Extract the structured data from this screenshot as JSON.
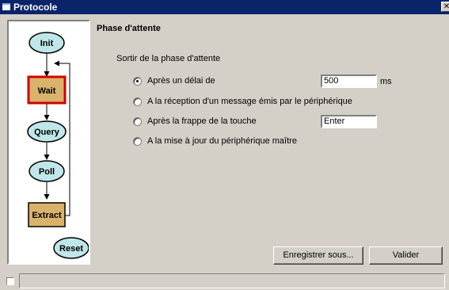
{
  "window": {
    "title": "Protocole",
    "close_glyph": "✕"
  },
  "flow": {
    "nodes": [
      {
        "id": "init",
        "label": "Init",
        "shape": "ellipse",
        "active": false
      },
      {
        "id": "wait",
        "label": "Wait",
        "shape": "box",
        "active": true
      },
      {
        "id": "query",
        "label": "Query",
        "shape": "ellipse",
        "active": false
      },
      {
        "id": "poll",
        "label": "Poll",
        "shape": "ellipse",
        "active": false
      },
      {
        "id": "extract",
        "label": "Extract",
        "shape": "box",
        "active": false
      },
      {
        "id": "reset",
        "label": "Reset",
        "shape": "ellipse",
        "active": false
      }
    ],
    "colors": {
      "ellipse_fill": "#bfe6e8",
      "box_fill": "#d9b36b",
      "active_border": "#d00000",
      "line": "#000000"
    }
  },
  "phase": {
    "title": "Phase d'attente",
    "group_label": "Sortir de la phase d'attente",
    "options": [
      {
        "label": "Après un délai de",
        "checked": true
      },
      {
        "label": "A la réception d'un message émis par le périphérique",
        "checked": false
      },
      {
        "label": "Après la frappe de la touche",
        "checked": false
      },
      {
        "label": "A la mise à jour du périphérique maître",
        "checked": false
      }
    ],
    "delay_value": "500",
    "delay_unit": "ms",
    "key_value": "Enter"
  },
  "buttons": {
    "save_as": "Enregistrer sous...",
    "validate": "Valider"
  }
}
